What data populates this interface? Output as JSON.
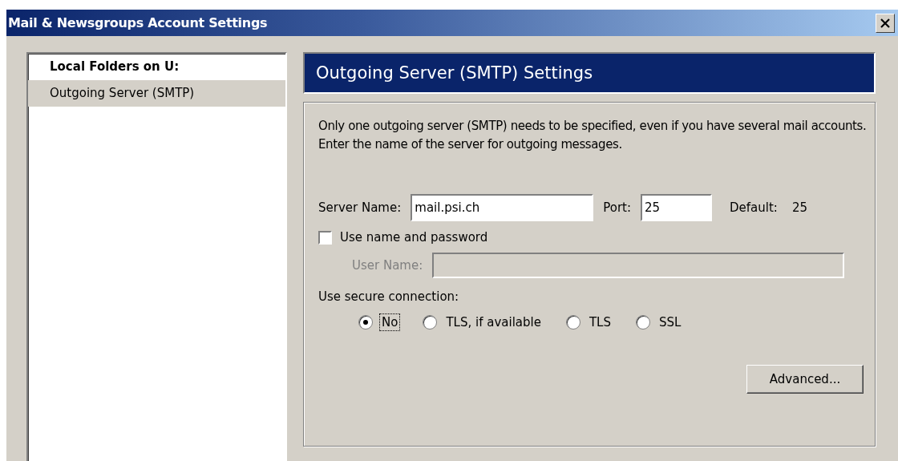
{
  "window": {
    "title": "Mail & Newsgroups Account Settings"
  },
  "sidebar": {
    "items": [
      {
        "label": "Local Folders on U:",
        "kind": "account",
        "selected": false
      },
      {
        "label": "Outgoing Server (SMTP)",
        "kind": "page",
        "selected": true
      }
    ]
  },
  "panel": {
    "title": "Outgoing Server (SMTP) Settings",
    "description": "Only one outgoing server (SMTP) needs to be specified, even if you have several mail accounts. Enter the name of the server for outgoing messages.",
    "server_name": {
      "label": "Server Name:",
      "value": "mail.psi.ch"
    },
    "port": {
      "label": "Port:",
      "value": "25"
    },
    "default_port": {
      "label": "Default:",
      "value": "25"
    },
    "use_name_and_password": {
      "label": "Use name and password",
      "checked": false
    },
    "user_name": {
      "label": "User Name:",
      "disabled": true
    },
    "secure_connection": {
      "label": "Use secure connection:",
      "options": [
        {
          "label": "No",
          "selected": true
        },
        {
          "label": "TLS, if available",
          "selected": false
        },
        {
          "label": "TLS",
          "selected": false
        },
        {
          "label": "SSL",
          "selected": false
        }
      ]
    },
    "advanced_button": "Advanced..."
  }
}
